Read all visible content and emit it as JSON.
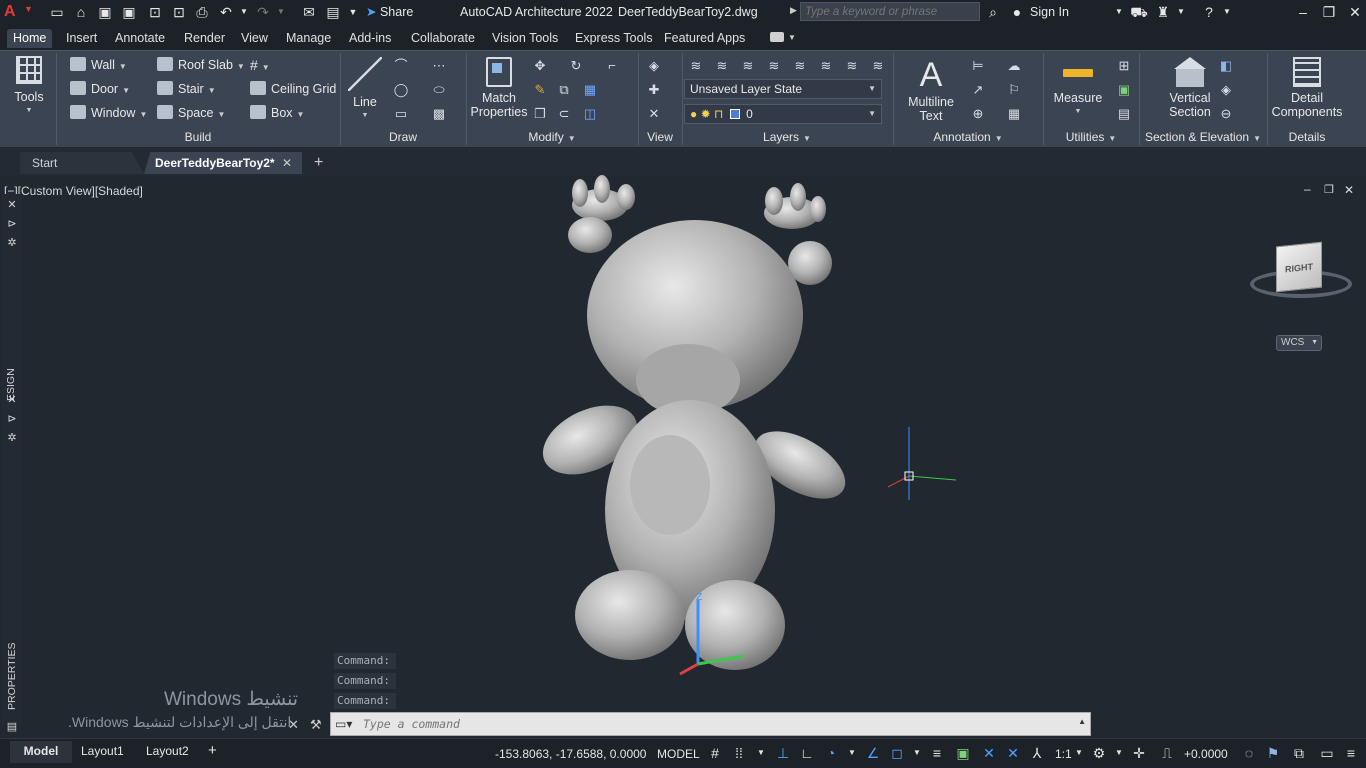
{
  "app": {
    "title": "AutoCAD Architecture 2022",
    "filename": "DeerTeddyBearToy2.dwg",
    "share_label": "Share",
    "search_placeholder": "Type a keyword or phrase",
    "signin_label": "Sign In"
  },
  "ribbon_tabs": [
    "Home",
    "Insert",
    "Annotate",
    "Render",
    "View",
    "Manage",
    "Add-ins",
    "Collaborate",
    "Vision Tools",
    "Express Tools",
    "Featured Apps"
  ],
  "ribbon": {
    "tools_label": "Tools",
    "build": {
      "label": "Build",
      "items": [
        "Wall",
        "Door",
        "Window",
        "Roof Slab",
        "Stair",
        "Space",
        "Ceiling Grid",
        "Box"
      ]
    },
    "draw": {
      "label": "Draw",
      "line_label": "Line"
    },
    "match_properties": "Match Properties",
    "modify_label": "Modify",
    "view_label": "View",
    "layers": {
      "label": "Layers",
      "layer_state": "Unsaved Layer State",
      "current_layer": "0"
    },
    "annotation": {
      "label": "Annotation",
      "multiline_text": "Multiline Text"
    },
    "utilities": {
      "label": "Utilities",
      "measure": "Measure"
    },
    "section_elevation": {
      "label": "Section & Elevation",
      "vertical_section": "Vertical Section"
    },
    "details": {
      "label": "Details",
      "detail_components": "Detail Components"
    }
  },
  "doc_tabs": {
    "start": "Start",
    "active": "DeerTeddyBearToy2*"
  },
  "viewport": {
    "label": "[−][Custom View][Shaded]",
    "viewcube_face": "RIGHT",
    "wcs_label": "WCS"
  },
  "side_palettes": {
    "design": "ESIGN",
    "properties": "PROPERTIES"
  },
  "command": {
    "history": [
      "Command:",
      "Command:",
      "Command:"
    ],
    "placeholder": "Type a command"
  },
  "watermark": {
    "line1": "Windows تنشيط",
    "line2": "انتقل إلى الإعدادات لتنشيط Windows."
  },
  "layout_tabs": [
    "Model",
    "Layout1",
    "Layout2"
  ],
  "status": {
    "coordinates": "-153.8063, -17.6588, 0.0000",
    "space": "MODEL",
    "scale": "1:1",
    "elevation": "+0.0000"
  },
  "colors": {
    "background": "#212830",
    "ribbon": "#3b4453",
    "accent": "#4aa3ff",
    "model": "#c9c9c9"
  }
}
